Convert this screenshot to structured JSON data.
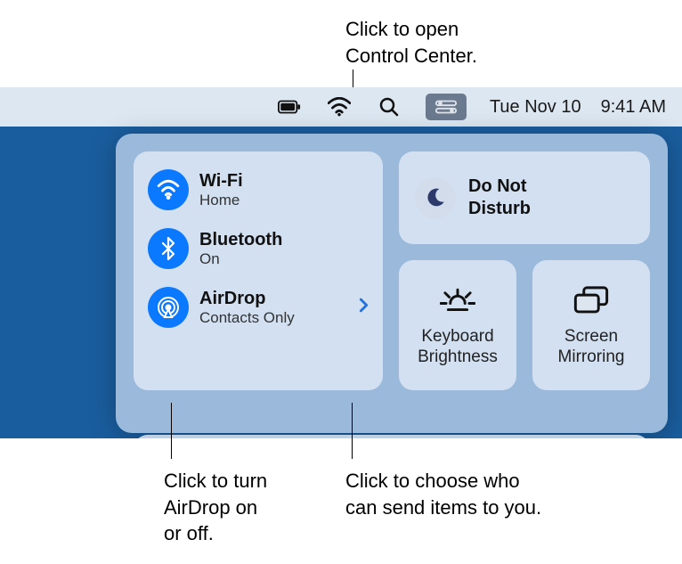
{
  "callouts": {
    "top": "Click to open\nControl Center.",
    "left": "Click to turn\nAirDrop on\nor off.",
    "right": "Click to choose who\ncan send items to you."
  },
  "menubar": {
    "date": "Tue Nov 10",
    "time": "9:41 AM"
  },
  "cc": {
    "wifi": {
      "title": "Wi-Fi",
      "sub": "Home"
    },
    "bluetooth": {
      "title": "Bluetooth",
      "sub": "On"
    },
    "airdrop": {
      "title": "AirDrop",
      "sub": "Contacts Only"
    },
    "dnd": {
      "title": "Do Not\nDisturb"
    },
    "keyboard": "Keyboard\nBrightness",
    "mirror": "Screen\nMirroring"
  }
}
